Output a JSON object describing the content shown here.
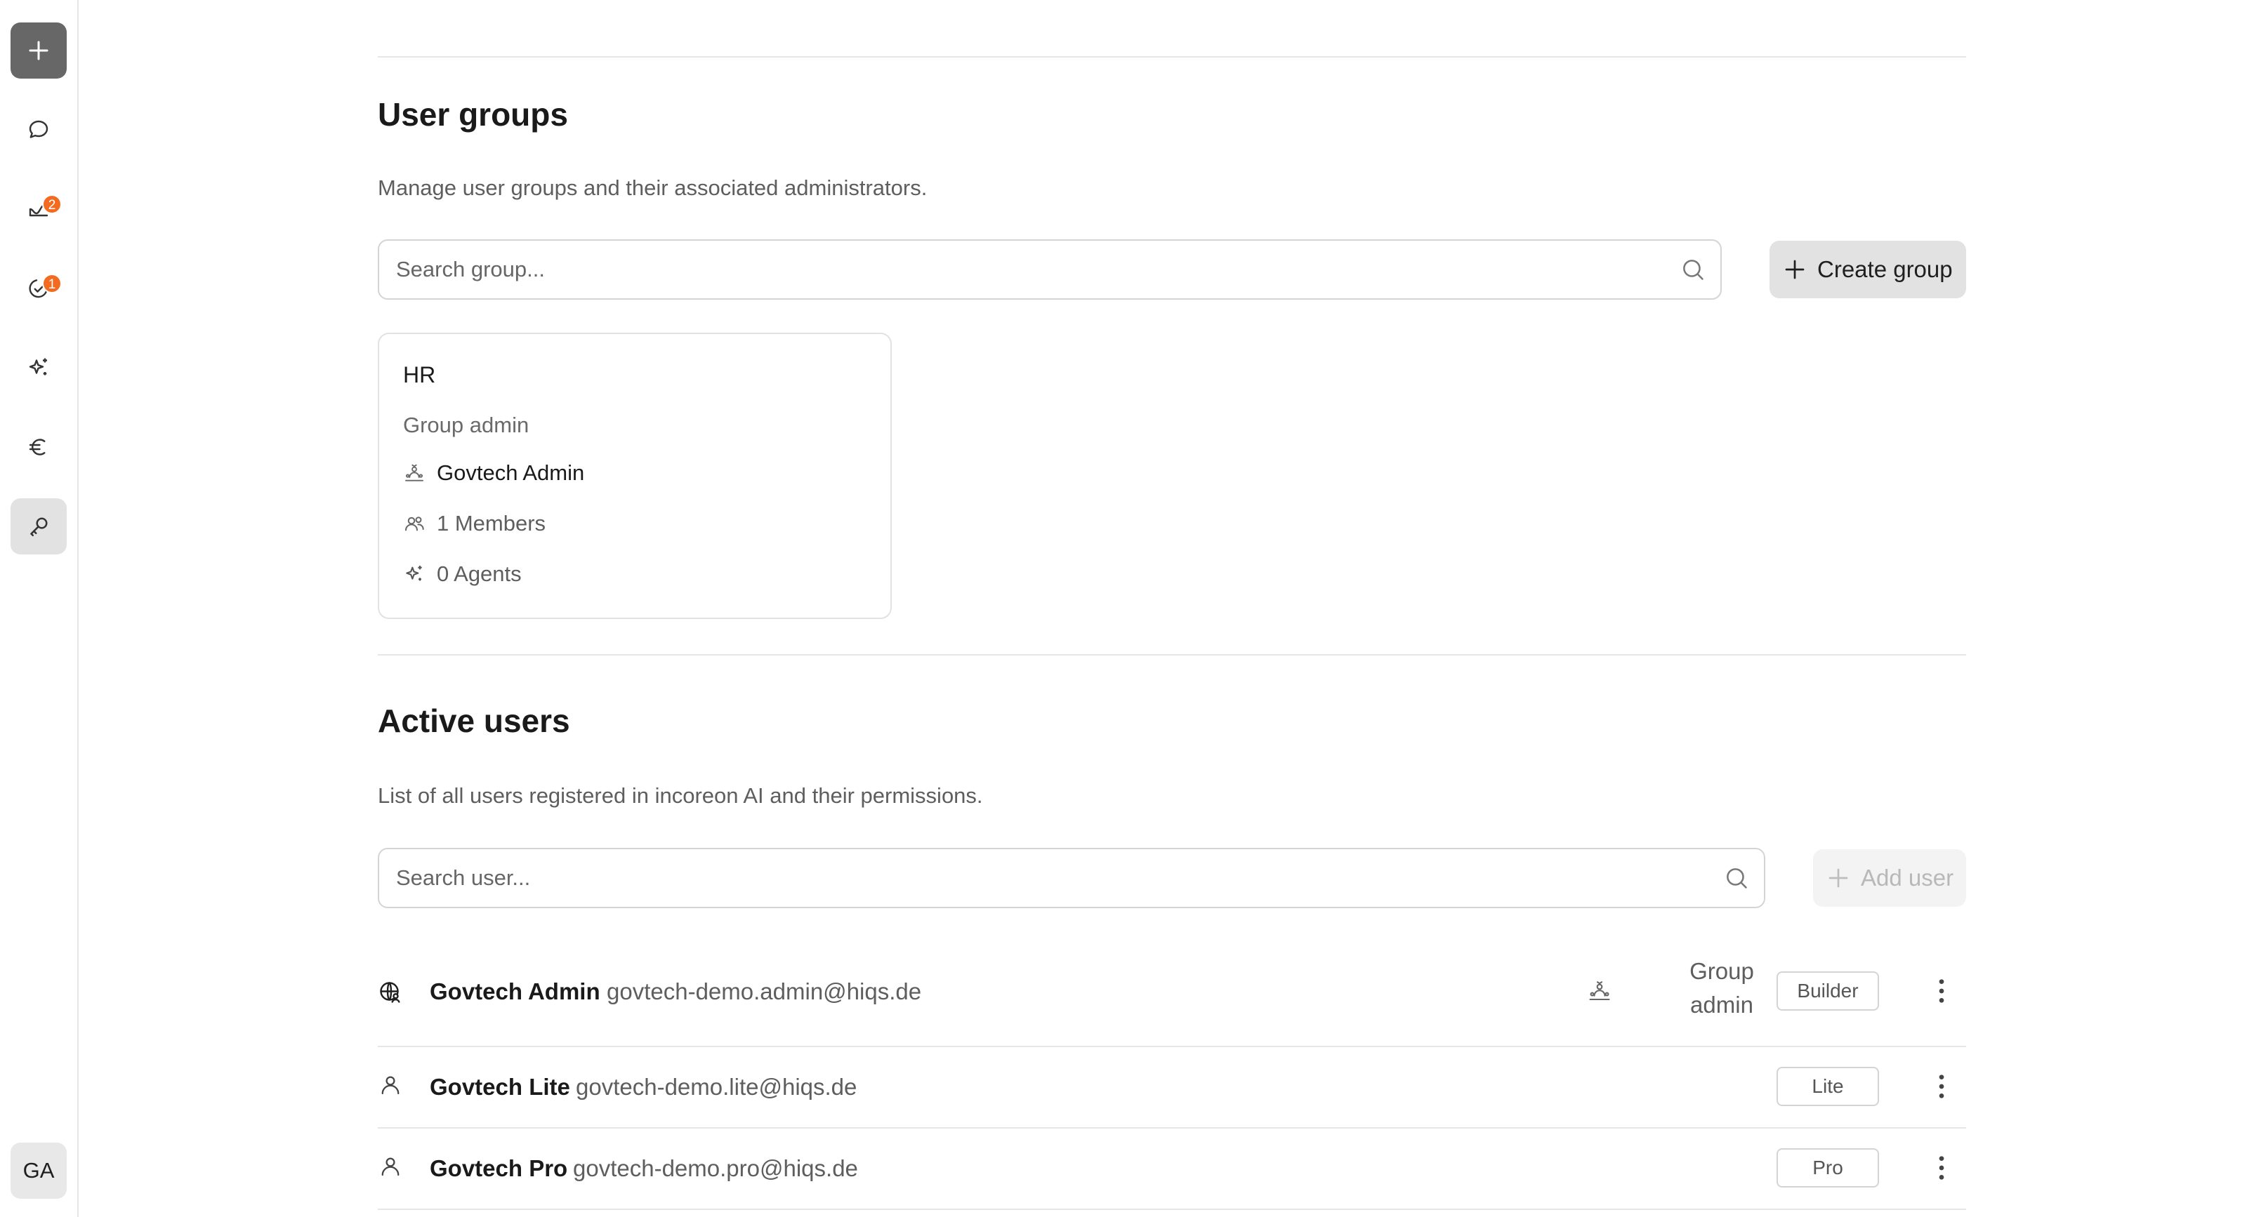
{
  "sidebar": {
    "new_label": "+",
    "items": [
      {
        "name": "chat-icon",
        "badge": ""
      },
      {
        "name": "workflows-icon",
        "badge": "2"
      },
      {
        "name": "tasks-icon",
        "badge": "1"
      },
      {
        "name": "agents-sparkle-icon",
        "badge": ""
      },
      {
        "name": "euro-icon",
        "badge": ""
      },
      {
        "name": "admin-key-icon",
        "badge": ""
      }
    ],
    "avatar_initials": "GA"
  },
  "user_groups": {
    "title": "User groups",
    "description": "Manage user groups and their associated administrators.",
    "search_placeholder": "Search group...",
    "create_label": "Create group",
    "card": {
      "name": "HR",
      "admin_heading": "Group admin",
      "admin_name": "Govtech Admin",
      "members": "1 Members",
      "agents": "0 Agents"
    }
  },
  "active_users": {
    "title": "Active users",
    "description": "List of all users registered in incoreon AI and their permissions.",
    "search_placeholder": "Search user...",
    "add_label": "Add user",
    "users": [
      {
        "name": "Govtech Admin",
        "email": "govtech-demo.admin@hiqs.de",
        "role_line1": "Group",
        "role_line2": "admin",
        "license": "Builder",
        "icon": "globe-user-icon"
      },
      {
        "name": "Govtech Lite",
        "email": "govtech-demo.lite@hiqs.de",
        "license": "Lite",
        "icon": "user-icon"
      },
      {
        "name": "Govtech Pro",
        "email": "govtech-demo.pro@hiqs.de",
        "license": "Pro",
        "icon": "user-icon"
      }
    ]
  },
  "colors": {
    "badge": "#f26b21",
    "primary_button": "#676767",
    "active_nav": "#e2e2e2"
  }
}
